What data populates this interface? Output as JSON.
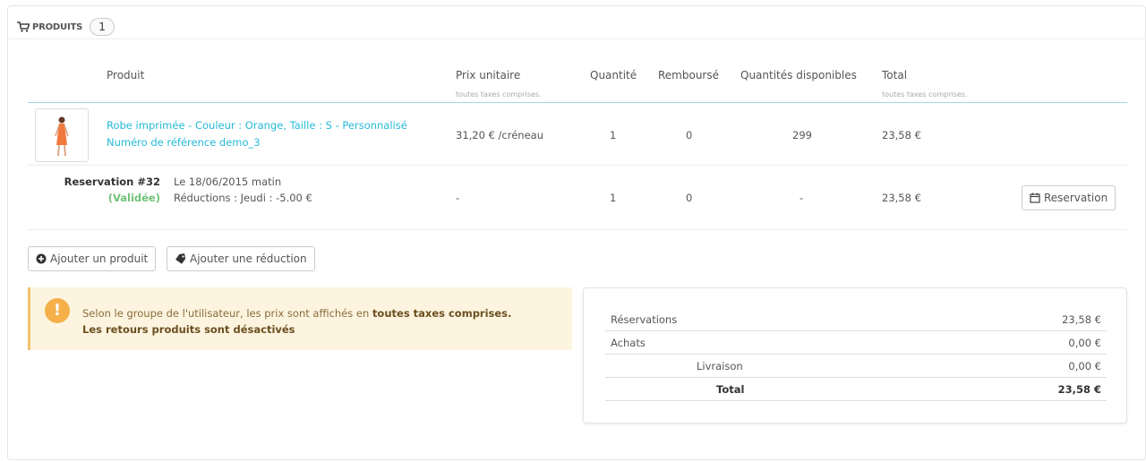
{
  "panel": {
    "title": "PRODUITS",
    "count": "1"
  },
  "table": {
    "headers": {
      "product": "Produit",
      "unit_price": "Prix unitaire",
      "unit_price_sub": "toutes taxes comprises.",
      "quantity": "Quantité",
      "refunded": "Remboursé",
      "available": "Quantités disponibles",
      "total": "Total",
      "total_sub": "toutes taxes comprises."
    },
    "product_row": {
      "name": "Robe imprimée - Couleur : Orange, Taille : S - Personnalisé",
      "reference": "Numéro de référence demo_3",
      "unit_price": "31,20 € /créneau",
      "quantity": "1",
      "refunded": "0",
      "available": "299",
      "total": "23,58 €"
    },
    "reservation_row": {
      "label": "Reservation #32",
      "status": "(Validée)",
      "date": "Le 18/06/2015 matin",
      "discount": "Réductions : Jeudi : -5.00 €",
      "unit_price": "-",
      "quantity": "1",
      "refunded": "0",
      "available": "-",
      "total": "23,58 €",
      "button_label": "Reservation"
    }
  },
  "actions": {
    "add_product": "Ajouter un produit",
    "add_discount": "Ajouter une réduction"
  },
  "alert": {
    "text_prefix": "Selon le groupe de l'utilisateur, les prix sont affichés en ",
    "text_bold": "toutes taxes comprises.",
    "line2": "Les retours produits sont désactivés"
  },
  "summary": {
    "reservations_label": "Réservations",
    "reservations_value": "23,58 €",
    "purchases_label": "Achats",
    "purchases_value": "0,00 €",
    "shipping_label": "Livraison",
    "shipping_value": "0,00 €",
    "total_label": "Total",
    "total_value": "23,58 €"
  },
  "colors": {
    "link": "#25b9d7",
    "validated": "#72c279",
    "alert_bg": "#fcf4df",
    "alert_icon": "#f5b04a"
  },
  "icons": [
    "cart-icon",
    "plus-circle-icon",
    "tag-icon",
    "calendar-icon",
    "warning-icon"
  ]
}
